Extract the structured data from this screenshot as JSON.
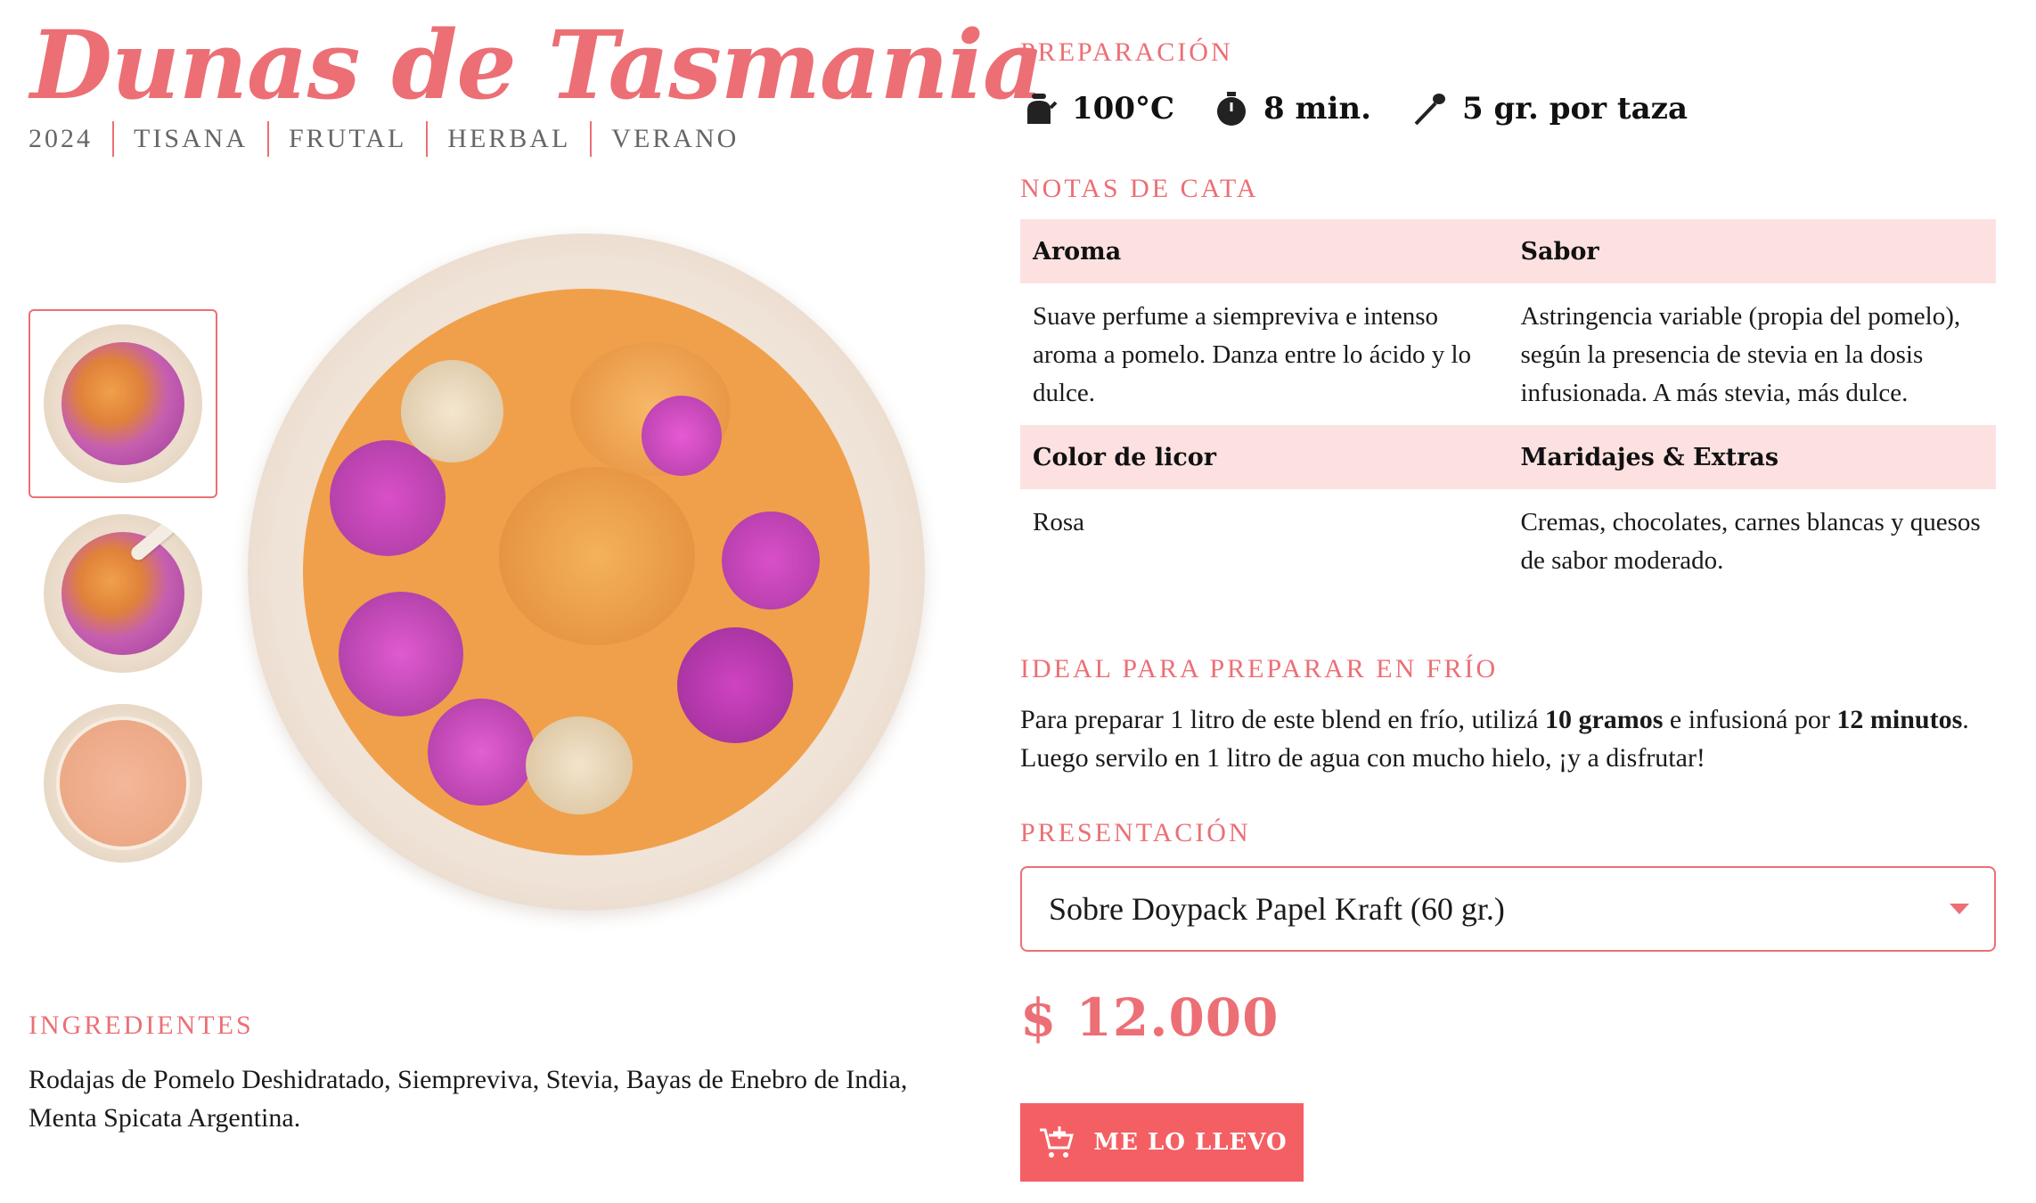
{
  "product": {
    "title": "Dunas de Tasmania",
    "tags": [
      "2024",
      "TISANA",
      "FRUTAL",
      "HERBAL",
      "VERANO"
    ]
  },
  "gallery": {
    "thumbnails": [
      {
        "icon": "bowl-image",
        "active": true
      },
      {
        "icon": "bowl-spoon-image",
        "active": false
      },
      {
        "icon": "tea-cup-image",
        "active": false
      }
    ],
    "main_image": "bowl-image"
  },
  "ingredients": {
    "label": "INGREDIENTES",
    "text": "Rodajas de Pomelo Deshidratado, Siempreviva, Stevia, Bayas de Enebro de India, Menta Spicata Argentina."
  },
  "preparation": {
    "label": "PREPARACIÓN",
    "temperature": "100°C",
    "time": "8 min.",
    "dose": "5 gr. por taza",
    "icons": [
      "kettle-icon",
      "timer-icon",
      "spoon-icon"
    ]
  },
  "tasting_notes": {
    "label": "NOTAS DE CATA",
    "aroma_header": "Aroma",
    "sabor_header": "Sabor",
    "aroma": "Suave perfume a siempreviva e intenso aroma a pomelo. Danza entre lo ácido y lo dulce.",
    "sabor": "Astringencia variable (propia del pomelo), según la presencia de stevia en la dosis infusionada. A más stevia, más dulce.",
    "color_header": "Color de licor",
    "maridajes_header": "Maridajes & Extras",
    "color": "Rosa",
    "maridajes": "Cremas, chocolates, carnes blancas y quesos de sabor moderado."
  },
  "cold_brew": {
    "label": "IDEAL PARA PREPARAR EN FRÍO",
    "text_1": "Para preparar 1 litro de este blend en frío, utilizá ",
    "bold_1": "10 gramos",
    "text_2": " e infusioná por ",
    "bold_2": "12 minutos",
    "text_3": ". Luego servilo en 1 litro de agua con mucho hielo, ¡y a disfrutar!"
  },
  "presentation": {
    "label": "PRESENTACIÓN",
    "selected": "Sobre Doypack Papel Kraft (60 gr.)"
  },
  "price": "$ 12.000",
  "buy_button": {
    "label": "ME LO LLEVO",
    "icon": "cart-add-icon"
  },
  "colors": {
    "accent": "#ec6f75",
    "button": "#f45f64",
    "table_header": "#fde1e1"
  }
}
